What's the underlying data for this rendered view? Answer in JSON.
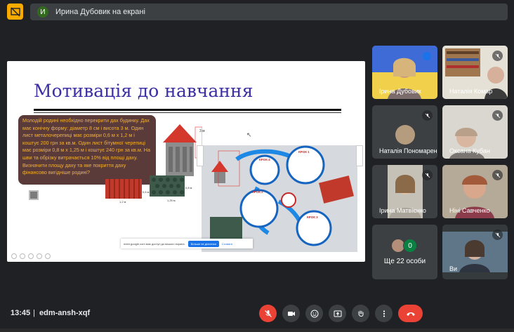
{
  "top_bar": {
    "avatar_letter": "И",
    "presenter_text": "Ирина Дубовик на екрані"
  },
  "slide": {
    "title": "Мотивація до навчання",
    "problem_text": "Молодій родині необхідно перекрити дах будинку. Дах має конічну форму: діаметр 8 см і висота 3 м. Один лист металочерепиці має розміри 0,6 м х 1,2 м і коштує 200 грн за кв.м. Один лист бітумної черепиці має розміри 0,8 м х 1,25 м і коштує 240 грн за кв.м. На шви та обрізку витрачається 10% від площі даху. Визначити площу даху та яке покриття даху фінансово вигідніше родині?",
    "dim_label_3m": "3 м",
    "dim_label_8m": "8 м",
    "tile1_w": "1,2 м",
    "tile1_h": "0,6 м",
    "tile2_w": "1,25 м",
    "tile2_h": "0,8 м",
    "step1": "КРОК 1",
    "step2": "КРОК 2",
    "step3": "КРОК 3",
    "step4": "КРОК 4",
    "share_notice": "meet.google.com має доступ до вашого екрана.",
    "share_stop": "Більше не ділитися",
    "share_hide": "Сховати"
  },
  "participants": [
    {
      "name": "Ірина Дубовик",
      "muted": false
    },
    {
      "name": "Наталія Комар",
      "muted": true
    },
    {
      "name": "Наталія Пономаренко",
      "muted": true
    },
    {
      "name": "Оксана Кубан",
      "muted": true
    },
    {
      "name": "Ірина Матвієнко",
      "muted": true
    },
    {
      "name": "Ніні Савченко",
      "muted": true
    },
    {
      "name": "Ви",
      "muted": true
    }
  ],
  "more": {
    "label": "Ще 22 особи",
    "count": "0"
  },
  "bottom": {
    "time": "13:45",
    "separator": "|",
    "meeting_code": "edm-ansh-xqf"
  },
  "colors": {
    "background": "#202124",
    "tile": "#3c4043",
    "accent_red": "#ea4335",
    "present_yellow": "#f9ab00",
    "slide_title": "#3b2fa3",
    "problem_text": "#f2b134"
  },
  "icons": [
    "present-icon",
    "mic-off-icon",
    "camera-icon",
    "emoji-icon",
    "present-screen-icon",
    "raise-hand-icon",
    "more-vert-icon",
    "end-call-icon"
  ]
}
